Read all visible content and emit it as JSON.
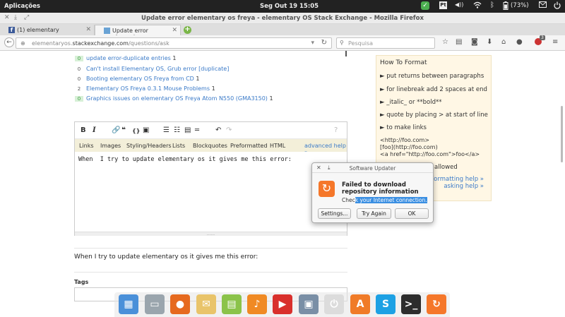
{
  "topbar": {
    "apps_label": "Aplicações",
    "clock": "Seg Out 19   15:05",
    "volume_label": "◀))",
    "battery": "(73%)"
  },
  "window": {
    "title": "Update error elementary os freya - elementary OS Stack Exchange - Mozilla Firefox"
  },
  "tabs": [
    {
      "label": "(1) elementary",
      "active": false,
      "favicon_color": "#3b5998"
    },
    {
      "label": "Update error elementary o...",
      "active": true,
      "favicon_color": "#6aa3d5"
    }
  ],
  "navbar": {
    "url_prefix": "elementaryos.",
    "url_domain": "stackexchange.com",
    "url_path": "/questions/ask",
    "search_placeholder": "Pesquisa",
    "notification_count": "3"
  },
  "related_questions": [
    {
      "count": "0",
      "title": "update error-duplicate entries",
      "score": "1",
      "highlight": true,
      "visited": true
    },
    {
      "count": "0",
      "title": "Can't install Elementary OS, Grub error [duplicate]",
      "score": "",
      "highlight": false,
      "visited": false
    },
    {
      "count": "0",
      "title": "Booting elementary OS Freya from CD",
      "score": "1",
      "highlight": false,
      "visited": false
    },
    {
      "count": "2",
      "title": "Elementary OS Freya 0.3.1 Mouse Problems",
      "score": "1",
      "highlight": false,
      "visited": false
    },
    {
      "count": "0",
      "title": "Graphics issues on elementary OS Freya Atom N550 (GMA3150)",
      "score": "1",
      "highlight": true,
      "visited": false
    }
  ],
  "editor": {
    "help_tabs": [
      "Links",
      "Images",
      "Styling/Headers",
      "Lists",
      "Blockquotes",
      "Preformatted",
      "HTML"
    ],
    "advanced_help": "advanced help »",
    "body_text": "When  I try to update elementary os it gives me this error:",
    "preview_text": "When I try to update elementary os it gives me this error:"
  },
  "tags_label": "Tags",
  "sidebar": {
    "title": "How To Format",
    "tips": [
      "► put returns between paragraphs",
      "► for linebreak add 2 spaces at end",
      "► _italic_ or **bold**",
      "► quote by placing > at start of line",
      "► to make links"
    ],
    "code_lines": [
      "<http://foo.com>",
      "[foo](http://foo.com)",
      "<a href=\"http://foo.com\">foo</a>"
    ],
    "allowed_text": "allowed",
    "formatting_help": "formatting help »",
    "asking_help": "asking help »"
  },
  "dialog": {
    "title": "Software Updater",
    "heading": "Failed to download repository information",
    "message_pre": "Chec",
    "message_sel": "k your Internet connection.",
    "settings_button": "Settings...",
    "try_again_button": "Try Again",
    "ok_button": "OK"
  },
  "dock_apps": [
    {
      "name": "multitasking-view",
      "color": "#4a90d9",
      "glyph": "▦"
    },
    {
      "name": "files",
      "color": "#9aa5ad",
      "glyph": "▭"
    },
    {
      "name": "firefox",
      "color": "#e66a1f",
      "glyph": "●"
    },
    {
      "name": "mail",
      "color": "#e9c46a",
      "glyph": "✉"
    },
    {
      "name": "calendar",
      "color": "#8bc34a",
      "glyph": "▤"
    },
    {
      "name": "music",
      "color": "#f08a24",
      "glyph": "♪"
    },
    {
      "name": "videos",
      "color": "#d9302c",
      "glyph": "▶"
    },
    {
      "name": "photos",
      "color": "#7a8fa6",
      "glyph": "▣"
    },
    {
      "name": "system-settings",
      "color": "#dcdcdc",
      "glyph": "⏻"
    },
    {
      "name": "app-center",
      "color": "#f07b28",
      "glyph": "A"
    },
    {
      "name": "skype",
      "color": "#1da1e4",
      "glyph": "S"
    },
    {
      "name": "terminal",
      "color": "#2d2d2d",
      "glyph": ">_"
    },
    {
      "name": "software-updater",
      "color": "#f5772a",
      "glyph": "↻"
    }
  ]
}
